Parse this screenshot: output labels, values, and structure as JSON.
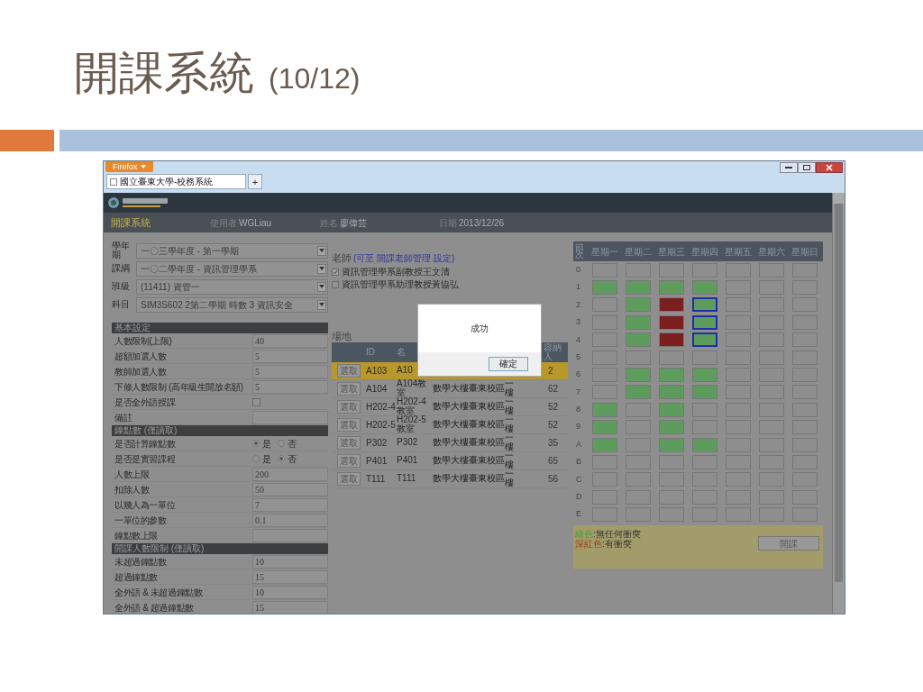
{
  "slide": {
    "title": "開課系統",
    "counter": "(10/12)"
  },
  "browser": {
    "menu_button": "Firefox",
    "tab_title": "國立臺東大學-校務系統",
    "new_tab": "+"
  },
  "app_header": {
    "system_name": "開課系統",
    "user_label": "使用者",
    "user": "WGLiau",
    "name_label": "姓名",
    "name": "廖偉芸",
    "date_label": "日期",
    "date": "2013/12/26"
  },
  "selects": [
    {
      "label": "學年期",
      "value": "一〇三學年度 - 第一學期"
    },
    {
      "label": "課綱",
      "value": "一〇二學年度 - 資訊管理學系"
    },
    {
      "label": "班級",
      "value": "(11411) 資管一"
    },
    {
      "label": "科目",
      "value": "SIM3S602 2第二學期 時數 3 資訊安全"
    }
  ],
  "sections": [
    {
      "title": "基本設定",
      "rows": [
        {
          "kind": "text",
          "label": "人數限制(上限)",
          "value": "40"
        },
        {
          "kind": "text",
          "label": "超額加選人數",
          "value": "5"
        },
        {
          "kind": "text",
          "label": "教師加選人數",
          "value": "5"
        },
        {
          "kind": "text",
          "label": "下修人數限制 (高年級生開放名額)",
          "value": "5"
        },
        {
          "kind": "checkbox",
          "label": "是否全外語授課",
          "checked": false
        },
        {
          "kind": "text",
          "label": "備註"
        }
      ]
    },
    {
      "title": "鐘點數 (僅讀取)",
      "rows": [
        {
          "kind": "radio",
          "label": "是否計算鐘點數",
          "options": [
            {
              "label": "是",
              "selected": true
            },
            {
              "label": "否",
              "selected": false
            }
          ]
        },
        {
          "kind": "radio",
          "label": "是否是實習課程",
          "options": [
            {
              "label": "是",
              "selected": false
            },
            {
              "label": "否",
              "selected": true
            }
          ]
        },
        {
          "kind": "text",
          "label": "人數上限",
          "value": "200"
        },
        {
          "kind": "text",
          "label": "扣除人數",
          "value": "50"
        },
        {
          "kind": "text",
          "label": "以幾人為一單位",
          "value": "7"
        },
        {
          "kind": "text",
          "label": "一單位的參數",
          "value": "0.1"
        },
        {
          "kind": "text",
          "label": "鐘點數上限"
        }
      ]
    },
    {
      "title": "開課人數限制 (僅讀取)",
      "rows": [
        {
          "kind": "text",
          "label": "未超過鐘點數",
          "value": "10"
        },
        {
          "kind": "text",
          "label": "超過鐘點數",
          "value": "15"
        },
        {
          "kind": "text",
          "label": "全外語 & 未超過鐘點數",
          "value": "10"
        },
        {
          "kind": "text",
          "label": "全外語 & 超過鐘點數",
          "value": "15"
        }
      ]
    }
  ],
  "teachers": {
    "heading": "老師",
    "link": "(可至 開課老師管理 設定)",
    "items": [
      {
        "label": "資訊管理學系副教授王文清",
        "checked": true
      },
      {
        "label": "資訊管理學系助理教授黃協弘",
        "checked": false
      }
    ]
  },
  "venue": {
    "heading": "場地",
    "columns": [
      "ID",
      "名",
      "容納人"
    ],
    "rows": [
      {
        "button": "選取",
        "selected": true,
        "id": "A103",
        "name": "A10",
        "capacity": "2"
      },
      {
        "button": "選取",
        "selected": false,
        "id": "A104",
        "name": "A104教室",
        "building": "數學大樓",
        "campus": "臺東校區",
        "floor": "一樓",
        "capacity": "62"
      },
      {
        "button": "選取",
        "selected": false,
        "id": "H202-4",
        "name": "H202-4教室",
        "building": "數學大樓",
        "campus": "臺東校區",
        "floor": "一樓",
        "capacity": "52"
      },
      {
        "button": "選取",
        "selected": false,
        "id": "H202-5",
        "name": "H202-5教室",
        "building": "數學大樓",
        "campus": "臺東校區",
        "floor": "一樓",
        "capacity": "52"
      },
      {
        "button": "選取",
        "selected": false,
        "id": "P302",
        "name": "P302",
        "building": "數學大樓",
        "campus": "臺東校區",
        "floor": "一樓",
        "capacity": "35"
      },
      {
        "button": "選取",
        "selected": false,
        "id": "P401",
        "name": "P401",
        "building": "數學大樓",
        "campus": "臺東校區",
        "floor": "一樓",
        "capacity": "65"
      },
      {
        "button": "選取",
        "selected": false,
        "id": "T111",
        "name": "T111",
        "building": "數學大樓",
        "campus": "臺東校區",
        "floor": "一樓",
        "capacity": "56"
      }
    ]
  },
  "schedule": {
    "corner": "節次",
    "days": [
      "星期一",
      "星期二",
      "星期三",
      "星期四",
      "星期五",
      "星期六",
      "星期日"
    ],
    "rows": [
      {
        "label": "0",
        "cells": [
          {
            "color": "#8e8e8e",
            "selected": false
          },
          {
            "color": "#8e8e8e",
            "selected": false
          },
          {
            "color": "#8e8e8e",
            "selected": false
          },
          {
            "color": "#8e8e8e",
            "selected": false
          },
          {
            "color": "#8e8e8e",
            "selected": false
          },
          {
            "color": "#8e8e8e",
            "selected": false
          },
          {
            "color": "#8e8e8e",
            "selected": false
          }
        ]
      },
      {
        "label": "1",
        "cells": [
          {
            "color": "#5e9c5e",
            "selected": false
          },
          {
            "color": "#5e9c5e",
            "selected": false
          },
          {
            "color": "#5e9c5e",
            "selected": false
          },
          {
            "color": "#5e9c5e",
            "selected": false
          },
          {
            "color": "#8e8e8e",
            "selected": false
          },
          {
            "color": "#8e8e8e",
            "selected": false
          },
          {
            "color": "#8e8e8e",
            "selected": false
          }
        ]
      },
      {
        "label": "2",
        "cells": [
          {
            "color": "#8e8e8e",
            "selected": false
          },
          {
            "color": "#5e9c5e",
            "selected": false
          },
          {
            "color": "#7a1e1e",
            "selected": false
          },
          {
            "color": "#5e9c5e",
            "selected": true
          },
          {
            "color": "#8e8e8e",
            "selected": false
          },
          {
            "color": "#8e8e8e",
            "selected": false
          },
          {
            "color": "#8e8e8e",
            "selected": false
          }
        ]
      },
      {
        "label": "3",
        "cells": [
          {
            "color": "#8e8e8e",
            "selected": false
          },
          {
            "color": "#5e9c5e",
            "selected": false
          },
          {
            "color": "#7a1e1e",
            "selected": false
          },
          {
            "color": "#5e9c5e",
            "selected": true
          },
          {
            "color": "#8e8e8e",
            "selected": false
          },
          {
            "color": "#8e8e8e",
            "selected": false
          },
          {
            "color": "#8e8e8e",
            "selected": false
          }
        ]
      },
      {
        "label": "4",
        "cells": [
          {
            "color": "#8e8e8e",
            "selected": false
          },
          {
            "color": "#5e9c5e",
            "selected": false
          },
          {
            "color": "#7a1e1e",
            "selected": false
          },
          {
            "color": "#5e9c5e",
            "selected": true
          },
          {
            "color": "#8e8e8e",
            "selected": false
          },
          {
            "color": "#8e8e8e",
            "selected": false
          },
          {
            "color": "#8e8e8e",
            "selected": false
          }
        ]
      },
      {
        "label": "5",
        "cells": [
          {
            "color": "#8e8e8e",
            "selected": false
          },
          {
            "color": "#8e8e8e",
            "selected": false
          },
          {
            "color": "#8e8e8e",
            "selected": false
          },
          {
            "color": "#8e8e8e",
            "selected": false
          },
          {
            "color": "#8e8e8e",
            "selected": false
          },
          {
            "color": "#8e8e8e",
            "selected": false
          },
          {
            "color": "#8e8e8e",
            "selected": false
          }
        ]
      },
      {
        "label": "6",
        "cells": [
          {
            "color": "#8e8e8e",
            "selected": false
          },
          {
            "color": "#5e9c5e",
            "selected": false
          },
          {
            "color": "#5e9c5e",
            "selected": false
          },
          {
            "color": "#5e9c5e",
            "selected": false
          },
          {
            "color": "#8e8e8e",
            "selected": false
          },
          {
            "color": "#8e8e8e",
            "selected": false
          },
          {
            "color": "#8e8e8e",
            "selected": false
          }
        ]
      },
      {
        "label": "7",
        "cells": [
          {
            "color": "#8e8e8e",
            "selected": false
          },
          {
            "color": "#5e9c5e",
            "selected": false
          },
          {
            "color": "#5e9c5e",
            "selected": false
          },
          {
            "color": "#5e9c5e",
            "selected": false
          },
          {
            "color": "#8e8e8e",
            "selected": false
          },
          {
            "color": "#8e8e8e",
            "selected": false
          },
          {
            "color": "#8e8e8e",
            "selected": false
          }
        ]
      },
      {
        "label": "8",
        "cells": [
          {
            "color": "#5e9c5e",
            "selected": false
          },
          {
            "color": "#8e8e8e",
            "selected": false
          },
          {
            "color": "#5e9c5e",
            "selected": false
          },
          {
            "color": "#8e8e8e",
            "selected": false
          },
          {
            "color": "#8e8e8e",
            "selected": false
          },
          {
            "color": "#8e8e8e",
            "selected": false
          },
          {
            "color": "#8e8e8e",
            "selected": false
          }
        ]
      },
      {
        "label": "9",
        "cells": [
          {
            "color": "#5e9c5e",
            "selected": false
          },
          {
            "color": "#8e8e8e",
            "selected": false
          },
          {
            "color": "#5e9c5e",
            "selected": false
          },
          {
            "color": "#8e8e8e",
            "selected": false
          },
          {
            "color": "#8e8e8e",
            "selected": false
          },
          {
            "color": "#8e8e8e",
            "selected": false
          },
          {
            "color": "#8e8e8e",
            "selected": false
          }
        ]
      },
      {
        "label": "A",
        "cells": [
          {
            "color": "#5e9c5e",
            "selected": false
          },
          {
            "color": "#8e8e8e",
            "selected": false
          },
          {
            "color": "#5e9c5e",
            "selected": false
          },
          {
            "color": "#5e9c5e",
            "selected": false
          },
          {
            "color": "#8e8e8e",
            "selected": false
          },
          {
            "color": "#8e8e8e",
            "selected": false
          },
          {
            "color": "#8e8e8e",
            "selected": false
          }
        ]
      },
      {
        "label": "B",
        "cells": [
          {
            "color": "#8e8e8e",
            "selected": false
          },
          {
            "color": "#8e8e8e",
            "selected": false
          },
          {
            "color": "#8e8e8e",
            "selected": false
          },
          {
            "color": "#8e8e8e",
            "selected": false
          },
          {
            "color": "#8e8e8e",
            "selected": false
          },
          {
            "color": "#8e8e8e",
            "selected": false
          },
          {
            "color": "#8e8e8e",
            "selected": false
          }
        ]
      },
      {
        "label": "C",
        "cells": [
          {
            "color": "#8e8e8e",
            "selected": false
          },
          {
            "color": "#8e8e8e",
            "selected": false
          },
          {
            "color": "#8e8e8e",
            "selected": false
          },
          {
            "color": "#8e8e8e",
            "selected": false
          },
          {
            "color": "#8e8e8e",
            "selected": false
          },
          {
            "color": "#8e8e8e",
            "selected": false
          },
          {
            "color": "#8e8e8e",
            "selected": false
          }
        ]
      },
      {
        "label": "D",
        "cells": [
          {
            "color": "#8e8e8e",
            "selected": false
          },
          {
            "color": "#8e8e8e",
            "selected": false
          },
          {
            "color": "#8e8e8e",
            "selected": false
          },
          {
            "color": "#8e8e8e",
            "selected": false
          },
          {
            "color": "#8e8e8e",
            "selected": false
          },
          {
            "color": "#8e8e8e",
            "selected": false
          },
          {
            "color": "#8e8e8e",
            "selected": false
          }
        ]
      },
      {
        "label": "E",
        "cells": [
          {
            "color": "#8e8e8e",
            "selected": false
          },
          {
            "color": "#8e8e8e",
            "selected": false
          },
          {
            "color": "#8e8e8e",
            "selected": false
          },
          {
            "color": "#8e8e8e",
            "selected": false
          },
          {
            "color": "#8e8e8e",
            "selected": false
          },
          {
            "color": "#8e8e8e",
            "selected": false
          },
          {
            "color": "#8e8e8e",
            "selected": false
          }
        ]
      }
    ],
    "legend": [
      {
        "key": "綠色",
        "text": ":無任何衝突",
        "color": "#4f9a3f"
      },
      {
        "key": "深紅色",
        "text": ":有衝突",
        "color": "#9a3a1a"
      }
    ],
    "button": "開課"
  },
  "dialog": {
    "message": "成功",
    "button": "確定"
  }
}
